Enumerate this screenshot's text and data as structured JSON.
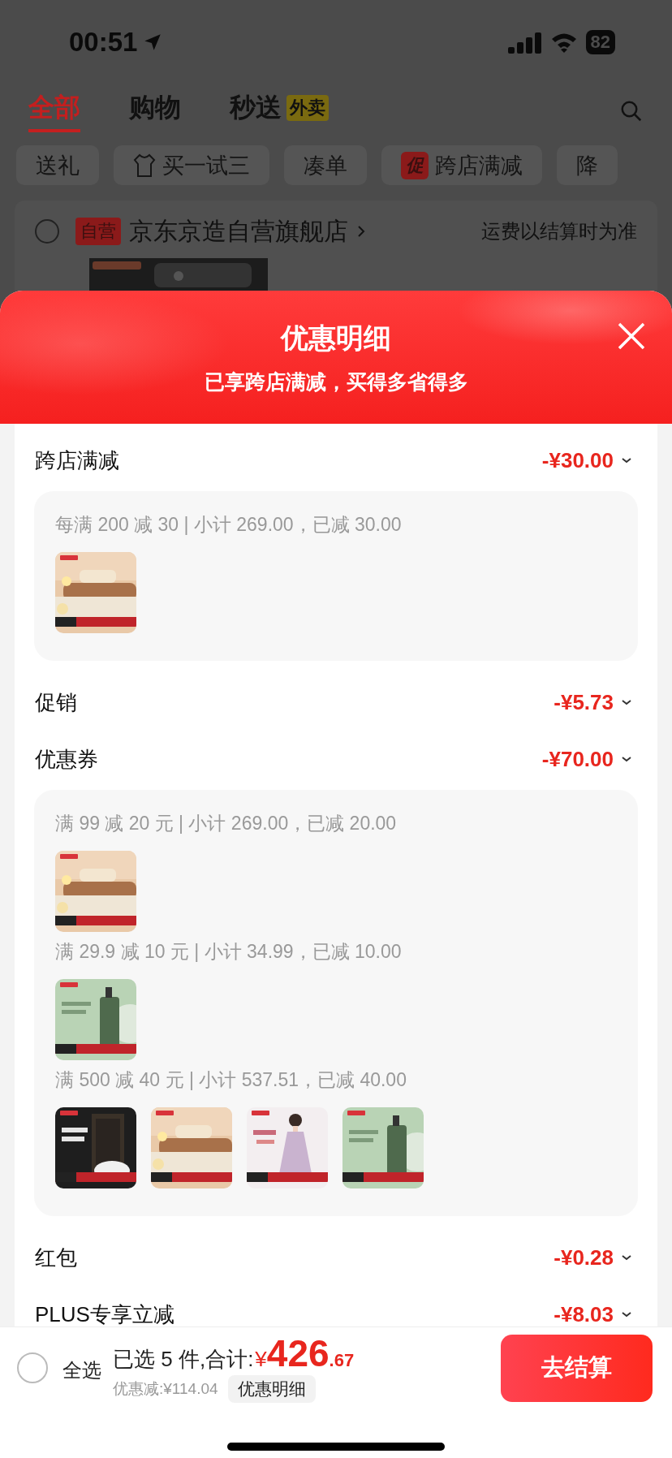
{
  "status_bar": {
    "time": "00:51",
    "battery": "82"
  },
  "tabs": [
    {
      "label": "全部",
      "selected": true
    },
    {
      "label": "购物",
      "selected": false
    },
    {
      "label": "秒送",
      "selected": false,
      "badge": "外卖"
    }
  ],
  "chips": [
    {
      "label": "送礼",
      "kind": "plain"
    },
    {
      "label": "买一试三",
      "kind": "icon"
    },
    {
      "label": "凑单",
      "kind": "plain"
    },
    {
      "label": "跨店满减",
      "kind": "promo",
      "tag": "促"
    },
    {
      "label": "降",
      "kind": "plain"
    }
  ],
  "store": {
    "checked": false,
    "tag": "自营",
    "name": "京东京造自营旗舰店",
    "note": "运费以结算时为准"
  },
  "sheet": {
    "title": "优惠明细",
    "subtitle": "已享跨店满减，买得多省得多",
    "sections": [
      {
        "label": "跨店满减",
        "amount": "-¥30.00",
        "groups": [
          {
            "rule": "每满 200 减 30 | 小计 269.00，已减 30.00"
          }
        ]
      },
      {
        "label": "促销",
        "amount": "-¥5.73"
      },
      {
        "label": "优惠券",
        "amount": "-¥70.00",
        "groups": [
          {
            "rule": "满 99 减 20 元 | 小计 269.00，已减 20.00"
          },
          {
            "rule": "满 29.9 减 10 元 | 小计 34.99，已减 10.00"
          },
          {
            "rule": "满 500 减 40 元 | 小计 537.51，已减 40.00"
          }
        ]
      },
      {
        "label": "红包",
        "amount": "-¥0.28"
      },
      {
        "label": "PLUS专享立减",
        "amount": "-¥8.03"
      }
    ]
  },
  "bottom_bar": {
    "select_all": {
      "label": "全选",
      "checked": false
    },
    "summary": "已选 5 件,合计:",
    "currency": "¥",
    "total_integer": "426",
    "total_decimal": ".67",
    "discount": "优惠减:¥114.04",
    "details_button": "优惠明细",
    "checkout": "去结算"
  }
}
